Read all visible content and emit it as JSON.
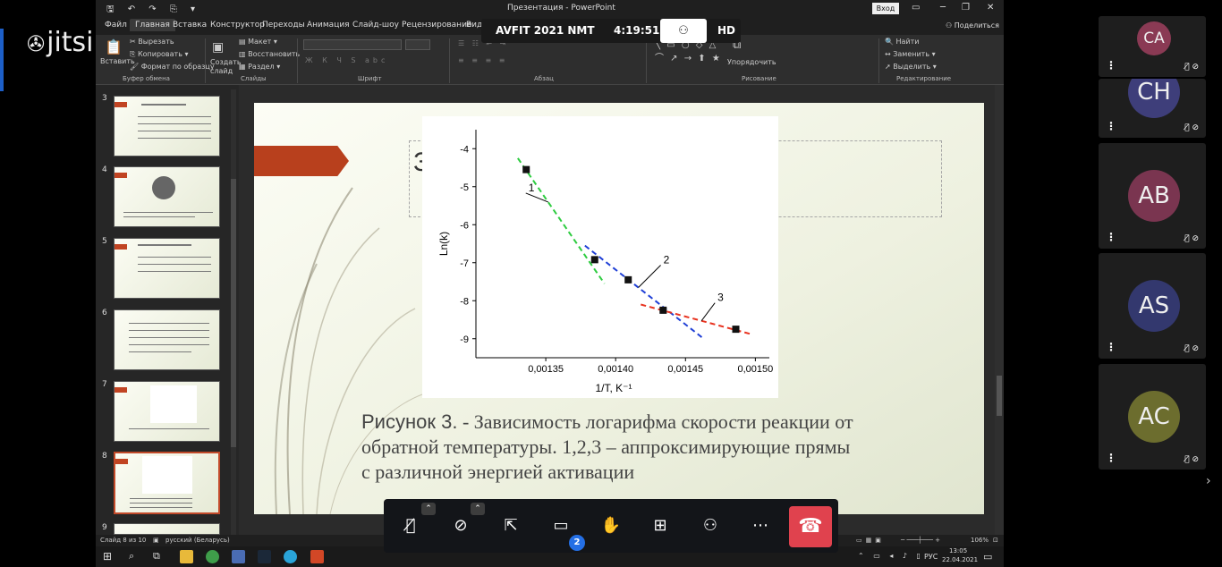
{
  "jitsi": {
    "logo": "jitsi"
  },
  "window": {
    "title": "Презентация - PowerPoint",
    "signin": "Вход",
    "share": "Поделиться"
  },
  "tabs": [
    "Файл",
    "Главная",
    "Вставка",
    "Конструктор",
    "Переходы",
    "Анимация",
    "Слайд-шоу",
    "Рецензирование",
    "Вид"
  ],
  "ribbon": {
    "paste": "Вставить",
    "cut": "Вырезать",
    "copy": "Копировать",
    "format_painter": "Формат по образцу",
    "clipboard_group": "Буфер обмена",
    "new_slide": "Создать слайд",
    "layout": "Макет",
    "reset": "Восстановить",
    "section": "Раздел",
    "slides_group": "Слайды",
    "font_group": "Шрифт",
    "paragraph_group": "Абзац",
    "arrange": "Упорядочить",
    "drawing_group": "Рисование",
    "find": "Найти",
    "replace": "Заменить",
    "select": "Выделить",
    "editing_group": "Редактирование"
  },
  "meeting": {
    "name": "AVFIT 2021 NMT",
    "duration": "4:19:51",
    "quality": "HD"
  },
  "slides": [
    {
      "num": "3"
    },
    {
      "num": "4"
    },
    {
      "num": "5"
    },
    {
      "num": "6"
    },
    {
      "num": "7"
    },
    {
      "num": "8"
    },
    {
      "num": "9"
    }
  ],
  "slide": {
    "title_partial": "З",
    "caption_label": "Рисунок 3.",
    "caption_text": "- Зависимость логарифма скорости реакции от обратной температуры. 1,2,3 – аппроксимирующие прямы с различной энергией активации",
    "colors": {
      "arrow": "#b8401d"
    }
  },
  "chart_data": {
    "type": "scatter",
    "xlabel": "1/T, K⁻¹",
    "ylabel": "Ln(k)",
    "xlim": [
      0.0013,
      0.00151
    ],
    "ylim": [
      -9.5,
      -3.5
    ],
    "x_ticks": [
      "0,00135",
      "0,00140",
      "0,00145",
      "0,00150"
    ],
    "y_ticks": [
      "-4",
      "-5",
      "-6",
      "-7",
      "-8",
      "-9"
    ],
    "points": [
      {
        "x": 0.001336,
        "y": -4.55
      },
      {
        "x": 0.001385,
        "y": -6.92
      },
      {
        "x": 0.001409,
        "y": -7.45
      },
      {
        "x": 0.001434,
        "y": -8.25
      },
      {
        "x": 0.001486,
        "y": -8.75
      }
    ],
    "series": [
      {
        "name": "1",
        "color": "#2ecc40",
        "x": [
          0.00133,
          0.001392
        ],
        "y": [
          -4.25,
          -7.55
        ]
      },
      {
        "name": "2",
        "color": "#1f3fd6",
        "x": [
          0.001378,
          0.001463
        ],
        "y": [
          -6.55,
          -9.0
        ]
      },
      {
        "name": "3",
        "color": "#e8321f",
        "x": [
          0.001418,
          0.001497
        ],
        "y": [
          -8.1,
          -8.88
        ]
      }
    ]
  },
  "status": {
    "slide_of": "Слайд 8 из 10",
    "language": "русский (Беларусь)",
    "zoom": "106%"
  },
  "taskbar": {
    "time": "13:05",
    "date": "22.04.2021",
    "lang": "РУС"
  },
  "toolbar": {
    "chat_count": "2"
  },
  "participants": [
    {
      "initials": "CA",
      "color": "#8a3a54"
    },
    {
      "initials": "CH",
      "color": "#3e3e7a"
    },
    {
      "initials": "AB",
      "color": "#7a3550"
    },
    {
      "initials": "AS",
      "color": "#33386e"
    },
    {
      "initials": "AC",
      "color": "#6c6d2e"
    }
  ]
}
